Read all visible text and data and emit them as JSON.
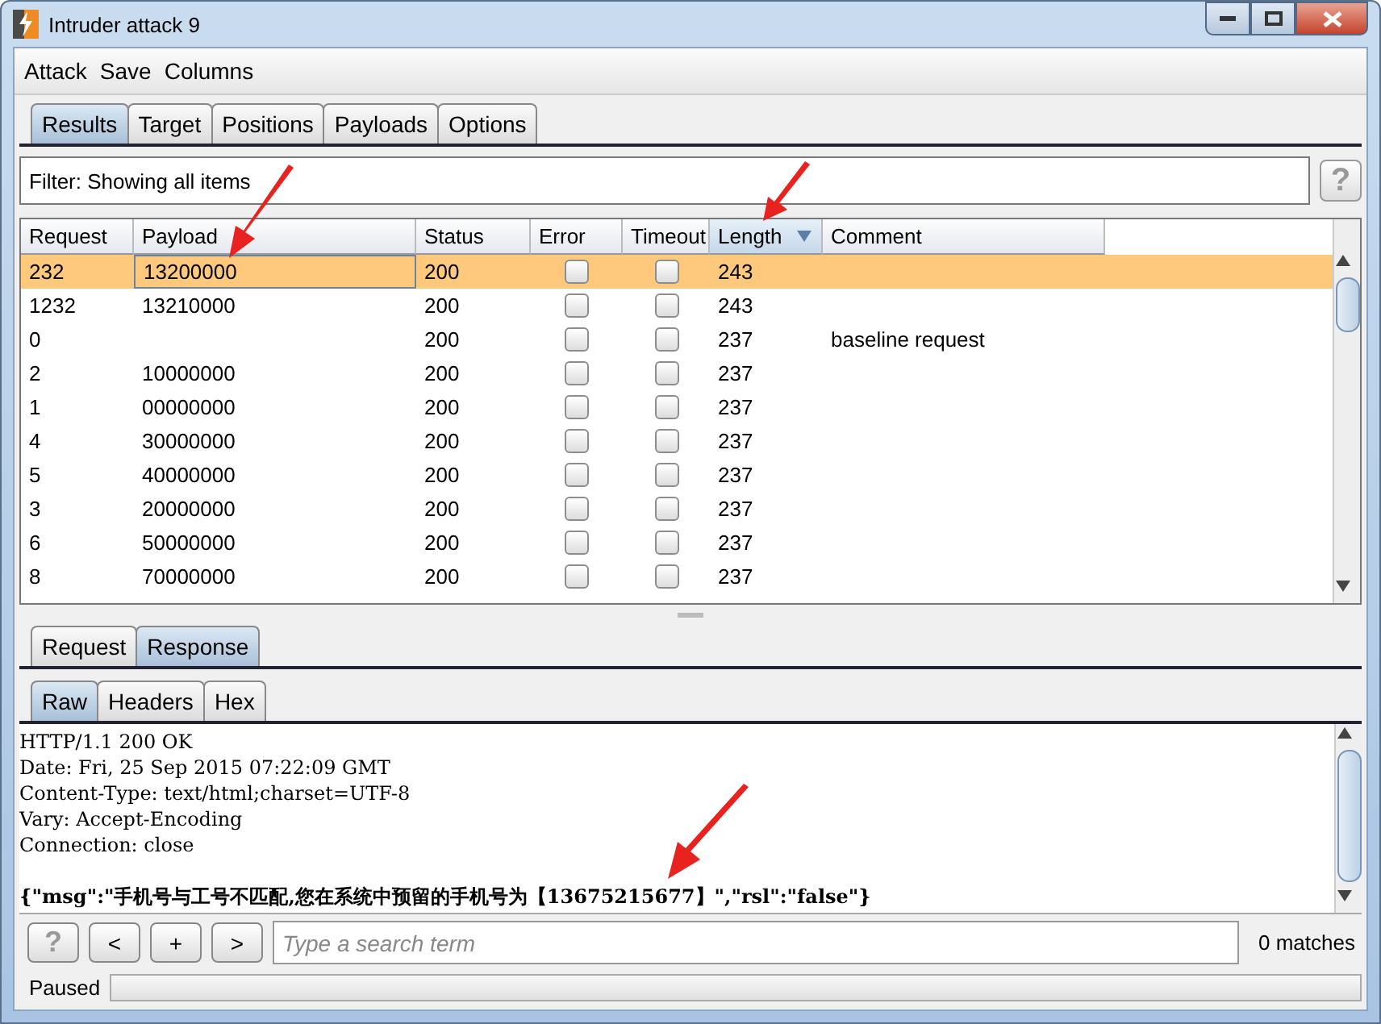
{
  "window": {
    "title": "Intruder attack 9"
  },
  "menu": [
    "Attack",
    "Save",
    "Columns"
  ],
  "tabs": [
    {
      "label": "Results",
      "selected": true
    },
    {
      "label": "Target",
      "selected": false
    },
    {
      "label": "Positions",
      "selected": false
    },
    {
      "label": "Payloads",
      "selected": false
    },
    {
      "label": "Options",
      "selected": false
    }
  ],
  "filter": {
    "text": "Filter: Showing all items",
    "help": "?"
  },
  "table": {
    "columns": [
      {
        "label": "Request",
        "sorted": false
      },
      {
        "label": "Payload",
        "sorted": false
      },
      {
        "label": "Status",
        "sorted": false
      },
      {
        "label": "Error",
        "sorted": false
      },
      {
        "label": "Timeout",
        "sorted": false
      },
      {
        "label": "Length",
        "sorted": true
      },
      {
        "label": "Comment",
        "sorted": false
      }
    ],
    "rows": [
      {
        "request": "232",
        "payload": "13200000",
        "status": "200",
        "error": false,
        "timeout": false,
        "length": "243",
        "selected": true
      },
      {
        "request": "1232",
        "payload": "13210000",
        "status": "200",
        "error": false,
        "timeout": false,
        "length": "243",
        "selected": false
      },
      {
        "request": "0",
        "status": "200",
        "error": false,
        "timeout": false,
        "length": "237",
        "comment": "baseline request",
        "selected": false
      },
      {
        "request": "2",
        "payload": "10000000",
        "status": "200",
        "error": false,
        "timeout": false,
        "length": "237",
        "selected": false
      },
      {
        "request": "1",
        "payload": "00000000",
        "status": "200",
        "error": false,
        "timeout": false,
        "length": "237",
        "selected": false
      },
      {
        "request": "4",
        "payload": "30000000",
        "status": "200",
        "error": false,
        "timeout": false,
        "length": "237",
        "selected": false
      },
      {
        "request": "5",
        "payload": "40000000",
        "status": "200",
        "error": false,
        "timeout": false,
        "length": "237",
        "selected": false
      },
      {
        "request": "3",
        "payload": "20000000",
        "status": "200",
        "error": false,
        "timeout": false,
        "length": "237",
        "selected": false
      },
      {
        "request": "6",
        "payload": "50000000",
        "status": "200",
        "error": false,
        "timeout": false,
        "length": "237",
        "selected": false
      },
      {
        "request": "8",
        "payload": "70000000",
        "status": "200",
        "error": false,
        "timeout": false,
        "length": "237",
        "selected": false
      }
    ]
  },
  "message_tabs": [
    {
      "label": "Request",
      "selected": false
    },
    {
      "label": "Response",
      "selected": true
    }
  ],
  "view_tabs": [
    {
      "label": "Raw",
      "selected": true
    },
    {
      "label": "Headers",
      "selected": false
    },
    {
      "label": "Hex",
      "selected": false
    }
  ],
  "response_lines": [
    "HTTP/1.1 200 OK",
    "Date: Fri, 25 Sep 2015 07:22:09 GMT",
    "Content-Type: text/html;charset=UTF-8",
    "Vary: Accept-Encoding",
    "Connection: close"
  ],
  "response_body": [
    "{\"msg\":\"手机号与工号不匹配,您在系统中预留的手机号为【13675215677】\",\"rsl\":\"false\"}"
  ],
  "search": {
    "buttons": [
      "?",
      "<",
      "+",
      ">"
    ],
    "placeholder": "Type a search term",
    "matches": "0 matches"
  },
  "status_bar": {
    "text": "Paused",
    "level": 0
  }
}
